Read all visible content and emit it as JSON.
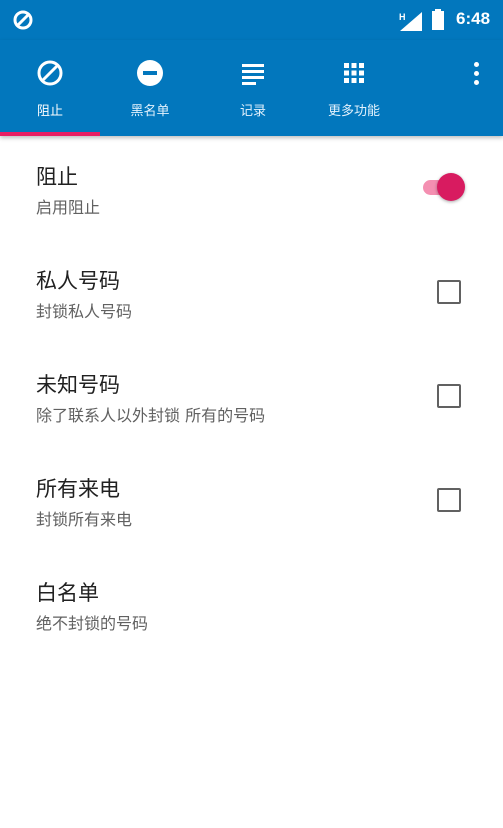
{
  "status_bar": {
    "time": "6:48",
    "app_icon": "block-icon",
    "signal_icon": "signal-icon",
    "battery_icon": "battery-icon"
  },
  "tabs": [
    {
      "label": "阻止",
      "icon": "block-icon",
      "active": true
    },
    {
      "label": "黑名单",
      "icon": "minus-circle-icon",
      "active": false
    },
    {
      "label": "记录",
      "icon": "list-icon",
      "active": false
    },
    {
      "label": "更多功能",
      "icon": "apps-grid-icon",
      "active": false
    }
  ],
  "settings": [
    {
      "title": "阻止",
      "subtitle": "启用阻止",
      "control": "switch",
      "checked": true
    },
    {
      "title": "私人号码",
      "subtitle": "封锁私人号码",
      "control": "checkbox",
      "checked": false
    },
    {
      "title": "未知号码",
      "subtitle": "除了联系人以外封锁 所有的号码",
      "control": "checkbox",
      "checked": false
    },
    {
      "title": "所有来电",
      "subtitle": "封锁所有来电",
      "control": "checkbox",
      "checked": false
    },
    {
      "title": "白名单",
      "subtitle": "绝不封锁的号码",
      "control": "none"
    }
  ],
  "colors": {
    "primary": "#0277bd",
    "accent": "#d81b60",
    "accent_light": "#f48fb1"
  }
}
